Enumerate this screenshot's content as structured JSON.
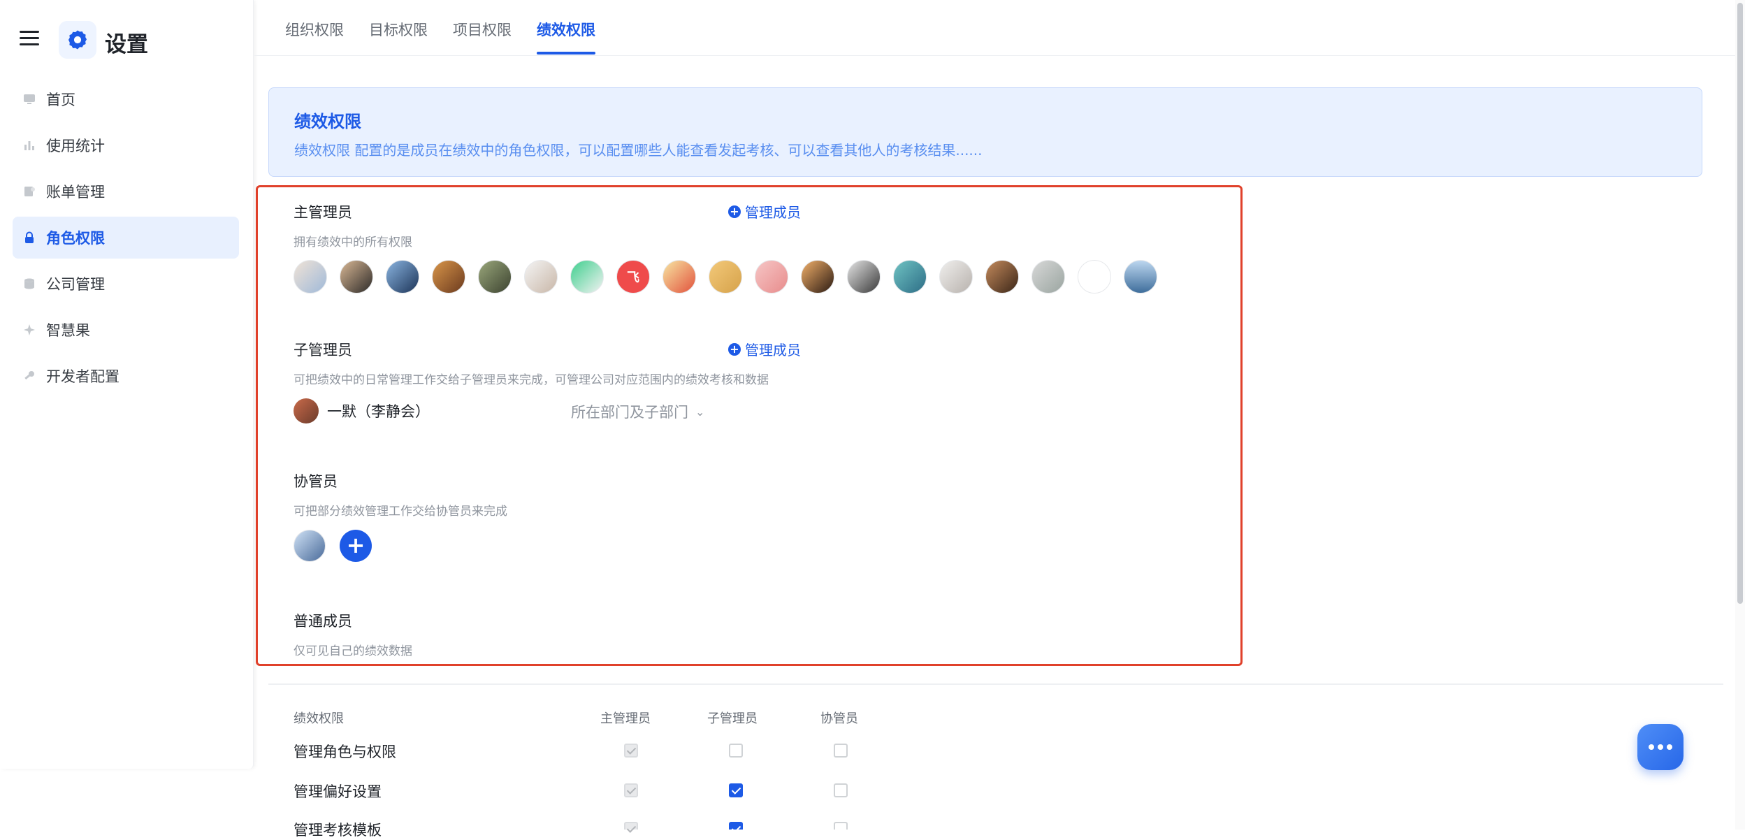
{
  "sidebar": {
    "title": "设置",
    "items": [
      {
        "label": "首页",
        "icon": "monitor-icon"
      },
      {
        "label": "使用统计",
        "icon": "bar-chart-icon"
      },
      {
        "label": "账单管理",
        "icon": "bill-icon"
      },
      {
        "label": "角色权限",
        "icon": "lock-icon",
        "active": true
      },
      {
        "label": "公司管理",
        "icon": "database-icon"
      },
      {
        "label": "智慧果",
        "icon": "sparkle-icon"
      },
      {
        "label": "开发者配置",
        "icon": "key-icon"
      }
    ]
  },
  "tabs": [
    {
      "label": "组织权限"
    },
    {
      "label": "目标权限"
    },
    {
      "label": "项目权限"
    },
    {
      "label": "绩效权限",
      "active": true
    }
  ],
  "banner": {
    "title": "绩效权限",
    "description": "绩效权限 配置的是成员在绩效中的角色权限，可以配置哪些人能查看发起考核、可以查看其他人的考核结果......"
  },
  "roles": {
    "main_admin": {
      "title": "主管理员",
      "desc": "拥有绩效中的所有权限",
      "manage_label": "管理成员",
      "avatar_glyphs": [
        "",
        "",
        "",
        "",
        "",
        "",
        "",
        "飞",
        "",
        "",
        "",
        "",
        "",
        "",
        "",
        "",
        "",
        "",
        ""
      ]
    },
    "sub_admin": {
      "title": "子管理员",
      "desc": "可把绩效中的日常管理工作交给子管理员来完成，可管理公司对应范围内的绩效考核和数据",
      "manage_label": "管理成员",
      "member_name": "一默（李静会）",
      "scope": "所在部门及子部门"
    },
    "assistant": {
      "title": "协管员",
      "desc": "可把部分绩效管理工作交给协管员来完成"
    },
    "member": {
      "title": "普通成员",
      "desc": "仅可见自己的绩效数据"
    }
  },
  "permissions": {
    "header": {
      "name": "绩效权限",
      "main": "主管理员",
      "sub": "子管理员",
      "assist": "协管员"
    },
    "rows": [
      {
        "label": "管理角色与权限",
        "main": "checked-disabled",
        "sub": "unchecked",
        "assist": "unchecked"
      },
      {
        "label": "管理偏好设置",
        "main": "checked-disabled",
        "sub": "checked",
        "assist": "unchecked"
      },
      {
        "label": "管理考核模板",
        "main": "checked-disabled",
        "sub": "checked",
        "assist": "unchecked"
      }
    ]
  },
  "colors": {
    "accent": "#1d5ae6",
    "highlight": "#e0412b"
  }
}
